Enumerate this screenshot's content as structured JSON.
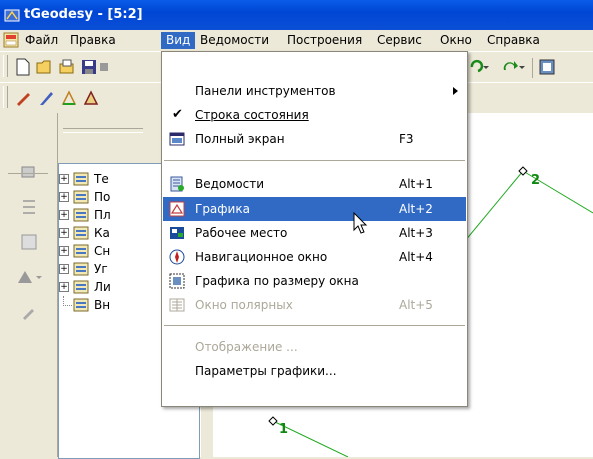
{
  "window": {
    "title": "tGeodesy - [5:2]"
  },
  "menubar": {
    "items": [
      {
        "label": "Файл"
      },
      {
        "label": "Правка"
      },
      {
        "label": "Вид"
      },
      {
        "label": "Ведомости"
      },
      {
        "label": "Построения"
      },
      {
        "label": "Сервис"
      },
      {
        "label": "Окно"
      },
      {
        "label": "Справка"
      }
    ],
    "active": "Вид"
  },
  "view_menu": {
    "toolbars": {
      "label": "Панели инструментов"
    },
    "statusbar": {
      "label": "Строка состояния",
      "checked": true
    },
    "fullscreen": {
      "label": "Полный экран",
      "shortcut": "F3"
    },
    "statements": {
      "label": "Ведомости",
      "shortcut": "Alt+1"
    },
    "graphics": {
      "label": "Графика",
      "shortcut": "Alt+2",
      "highlighted": true
    },
    "workspace": {
      "label": "Рабочее место",
      "shortcut": "Alt+3"
    },
    "navigator": {
      "label": "Навигационное окно",
      "shortcut": "Alt+4"
    },
    "fit_graphics": {
      "label": "Графика по размеру окна"
    },
    "polar_window": {
      "label": "Окно полярных",
      "shortcut": "Alt+5",
      "disabled": true
    },
    "display": {
      "label": "Отображение ...",
      "disabled": true
    },
    "graphics_params": {
      "label": "Параметры графики..."
    }
  },
  "tree": {
    "items": [
      {
        "label": "Те"
      },
      {
        "label": "По"
      },
      {
        "label": "Пл"
      },
      {
        "label": "Ка"
      },
      {
        "label": "Сн"
      },
      {
        "label": "Уг"
      },
      {
        "label": "Ли"
      },
      {
        "label": "Вн"
      }
    ]
  },
  "canvas": {
    "points": [
      {
        "label": "2"
      },
      {
        "label": "1"
      }
    ],
    "line_color": "#22aa22",
    "label_color": "#118811"
  },
  "colors": {
    "titlebar": "#0a5ce8",
    "highlight": "#316ac5",
    "menu_bg": "#ece9d8"
  },
  "icons": [
    "app-icon",
    "file-menu-icon",
    "new-file-icon",
    "open-folder-icon",
    "save-icon",
    "undo-icon",
    "redo-icon"
  ]
}
